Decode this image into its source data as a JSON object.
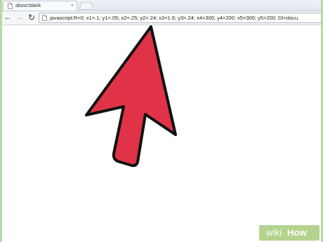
{
  "browser": {
    "tab": {
      "title": "about:blank",
      "close_glyph": "×",
      "icon": "document-icon"
    },
    "new_tab_icon": "new-tab-icon",
    "toolbar": {
      "back_glyph": "←",
      "forward_glyph": "→",
      "reload_glyph": "↻",
      "address": "javascript:R=0; x1=.1; y1=.05; x2=.25; y2=.24; x3=1.6; y3=.24; x4=300; y4=200; x5=300; y5=200; DI=docu",
      "address_icon": "document-icon"
    }
  },
  "content": {
    "illustration": "mouse-cursor-arrow",
    "colors": {
      "cursor_fill": "#e03347",
      "cursor_outline": "#111111",
      "page_background": "#ffffff",
      "border_background": "#b9d9a3"
    }
  },
  "watermark": {
    "wiki": "wiki",
    "how": "How"
  }
}
